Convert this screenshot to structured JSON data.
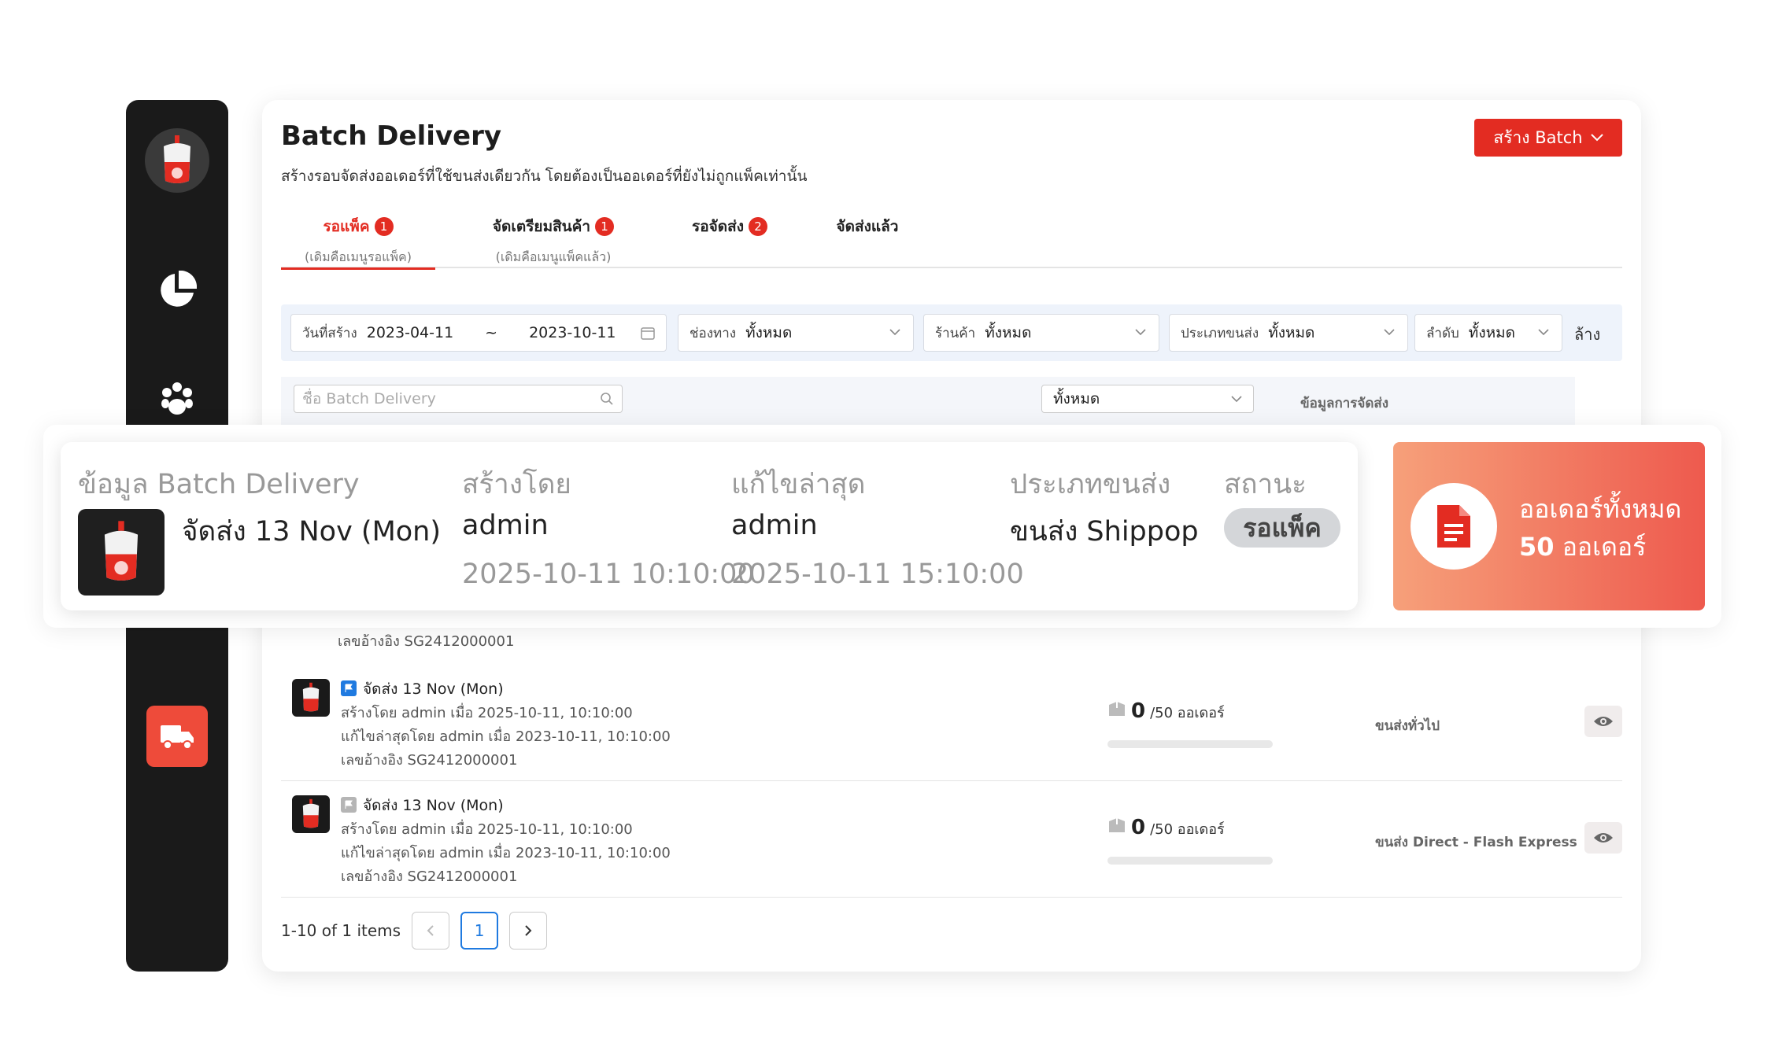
{
  "page": {
    "title": "Batch Delivery",
    "subtitle": "สร้างรอบจัดส่งออเดอร์ที่ใช้ขนส่งเดียวกัน โดยต้องเป็นออเดอร์ที่ยังไม่ถูกแพ็คเท่านั้น",
    "create_button": "สร้าง Batch"
  },
  "tabs": [
    {
      "label": "รอแพ็ค",
      "badge": "1",
      "sub": "(เดิมคือเมนูรอแพ็ค)",
      "active": true
    },
    {
      "label": "จัดเตรียมสินค้า",
      "badge": "1",
      "sub": "(เดิมคือเมนูแพ็คแล้ว)",
      "active": false
    },
    {
      "label": "รอจัดส่ง",
      "badge": "2",
      "sub": "",
      "active": false
    },
    {
      "label": "จัดส่งแล้ว",
      "badge": "",
      "sub": "",
      "active": false
    }
  ],
  "filters": {
    "created_label": "วันที่สร้าง",
    "date_from": "2023-04-11",
    "date_sep": "~",
    "date_to": "2023-10-11",
    "channel_label": "ช่องทาง",
    "channel_value": "ทั้งหมด",
    "shop_label": "ร้านค้า",
    "shop_value": "ทั้งหมด",
    "shiptype_label": "ประเภทขนส่ง",
    "shiptype_value": "ทั้งหมด",
    "order_label": "ลำดับ",
    "order_value": "ทั้งหมด",
    "clear": "ล้าง"
  },
  "search": {
    "placeholder": "ชื่อ Batch Delivery",
    "status_value": "ทั้งหมด",
    "shipping_info_header": "ข้อมูลการจัดส่ง"
  },
  "rows_partial_ref": "เลขอ้างอิง SG2412000001",
  "rows": [
    {
      "title": "จัดส่ง 13 Nov (Mon)",
      "created": "สร้างโดย admin เมื่อ 2025-10-11, 10:10:00",
      "edited": "แก้ไขล่าสุดโดย admin เมื่อ 2023-10-11, 10:10:00",
      "ref": "เลขอ้างอิง SG2412000001",
      "count": "0",
      "total": "/50 ออเดอร์",
      "progress": 0,
      "shipping": "ขนส่งทั่วไป",
      "flag_color": "#1f7ae0"
    },
    {
      "title": "จัดส่ง 13 Nov (Mon)",
      "created": "สร้างโดย admin เมื่อ 2025-10-11, 10:10:00",
      "edited": "แก้ไขล่าสุดโดย admin เมื่อ 2023-10-11, 10:10:00",
      "ref": "เลขอ้างอิง SG2412000001",
      "count": "0",
      "total": "/50 ออเดอร์",
      "progress": 0,
      "shipping": "ขนส่ง Direct - Flash Express",
      "flag_color": "#b5b5b5"
    }
  ],
  "pagination": {
    "summary": "1-10 of 1 items",
    "current": "1"
  },
  "overlay": {
    "info_header": "ข้อมูล Batch Delivery",
    "batch_name": "จัดส่ง 13 Nov (Mon)",
    "created_by_header": "สร้างโดย",
    "created_by": "admin",
    "created_at": "2025-10-11 10:10:00",
    "edited_header": "แก้ไขล่าสุด",
    "edited_by": "admin",
    "edited_at": "2025-10-11 15:10:00",
    "shiptype_header": "ประเภทขนส่ง",
    "shiptype": "ขนส่ง Shippop",
    "status_header": "สถานะ",
    "status": "รอแพ็ค",
    "orders_label": "ออเดอร์ทั้งหมด",
    "orders_count": "50",
    "orders_unit": "ออเดอร์"
  },
  "colors": {
    "brand_red": "#e32c22",
    "sidebar": "#1a1a1a",
    "active_nav": "#ee4b3a",
    "link_blue": "#1f7ae0"
  },
  "icons": {
    "logo": "sauce-bottle-icon",
    "nav": [
      "pie-chart-icon",
      "paw-icon",
      "truck-icon"
    ]
  }
}
